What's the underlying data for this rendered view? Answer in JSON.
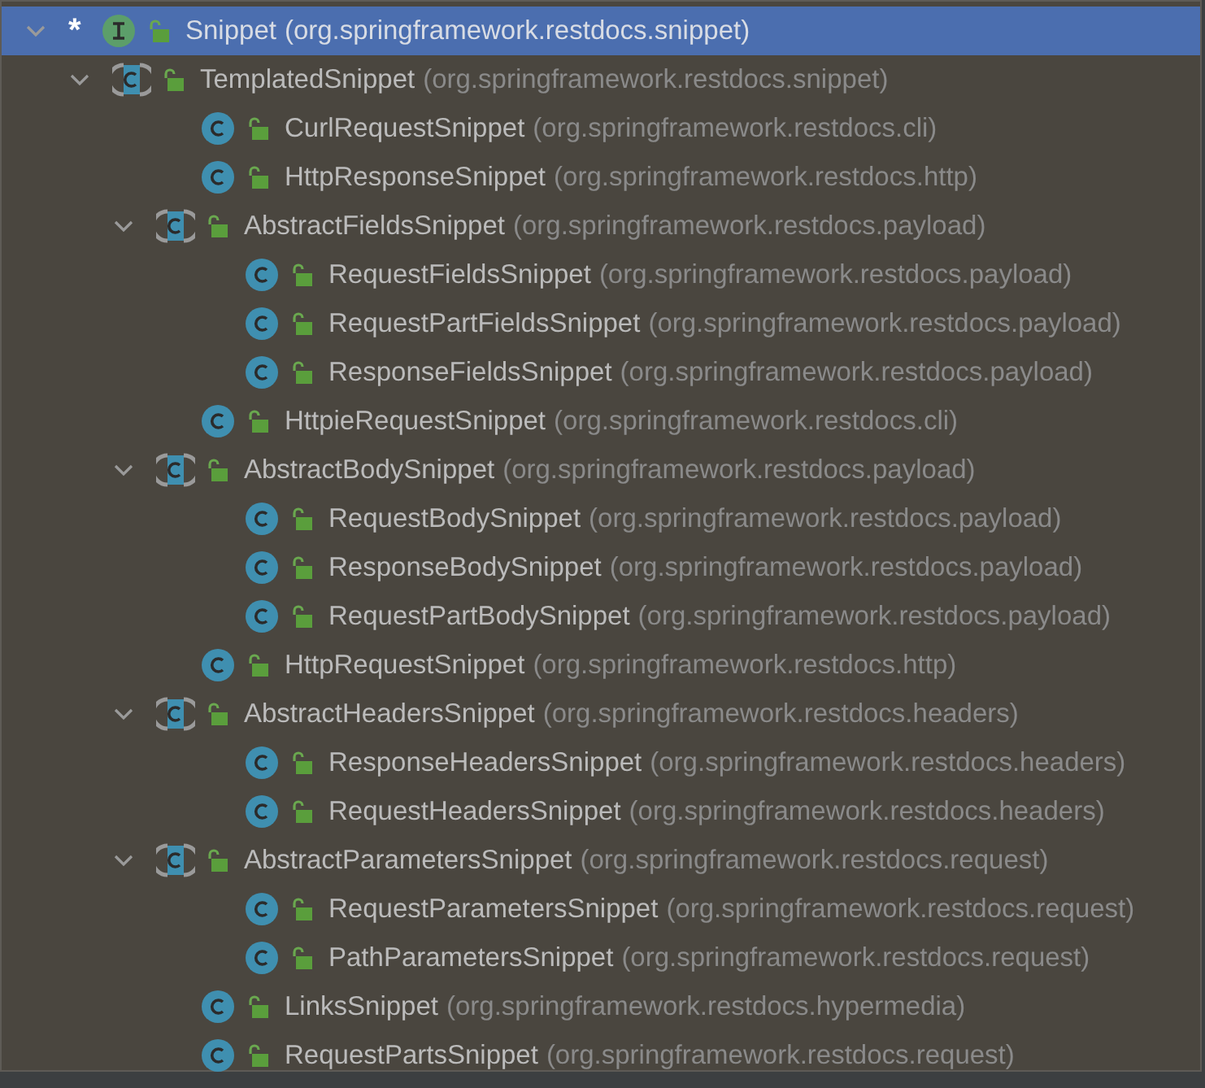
{
  "hierarchy": [
    {
      "name": "Snippet",
      "package": "(org.springframework.restdocs.snippet)",
      "kind": "interface",
      "marker": "*",
      "selected": true,
      "expanded": true,
      "children": [
        {
          "name": "TemplatedSnippet",
          "package": "(org.springframework.restdocs.snippet)",
          "kind": "abstract",
          "selected": false,
          "expanded": true,
          "children": [
            {
              "name": "CurlRequestSnippet",
              "package": "(org.springframework.restdocs.cli)",
              "kind": "class",
              "selected": false
            },
            {
              "name": "HttpResponseSnippet",
              "package": "(org.springframework.restdocs.http)",
              "kind": "class",
              "selected": false
            },
            {
              "name": "AbstractFieldsSnippet",
              "package": "(org.springframework.restdocs.payload)",
              "kind": "abstract",
              "selected": false,
              "expanded": true,
              "children": [
                {
                  "name": "RequestFieldsSnippet",
                  "package": "(org.springframework.restdocs.payload)",
                  "kind": "class",
                  "selected": false
                },
                {
                  "name": "RequestPartFieldsSnippet",
                  "package": "(org.springframework.restdocs.payload)",
                  "kind": "class",
                  "selected": false
                },
                {
                  "name": "ResponseFieldsSnippet",
                  "package": "(org.springframework.restdocs.payload)",
                  "kind": "class",
                  "selected": false
                }
              ]
            },
            {
              "name": "HttpieRequestSnippet",
              "package": "(org.springframework.restdocs.cli)",
              "kind": "class",
              "selected": false
            },
            {
              "name": "AbstractBodySnippet",
              "package": "(org.springframework.restdocs.payload)",
              "kind": "abstract",
              "selected": false,
              "expanded": true,
              "children": [
                {
                  "name": "RequestBodySnippet",
                  "package": "(org.springframework.restdocs.payload)",
                  "kind": "class",
                  "selected": false
                },
                {
                  "name": "ResponseBodySnippet",
                  "package": "(org.springframework.restdocs.payload)",
                  "kind": "class",
                  "selected": false
                },
                {
                  "name": "RequestPartBodySnippet",
                  "package": "(org.springframework.restdocs.payload)",
                  "kind": "class",
                  "selected": false
                }
              ]
            },
            {
              "name": "HttpRequestSnippet",
              "package": "(org.springframework.restdocs.http)",
              "kind": "class",
              "selected": false
            },
            {
              "name": "AbstractHeadersSnippet",
              "package": "(org.springframework.restdocs.headers)",
              "kind": "abstract",
              "selected": false,
              "expanded": true,
              "children": [
                {
                  "name": "ResponseHeadersSnippet",
                  "package": "(org.springframework.restdocs.headers)",
                  "kind": "class",
                  "selected": false
                },
                {
                  "name": "RequestHeadersSnippet",
                  "package": "(org.springframework.restdocs.headers)",
                  "kind": "class",
                  "selected": false
                }
              ]
            },
            {
              "name": "AbstractParametersSnippet",
              "package": "(org.springframework.restdocs.request)",
              "kind": "abstract",
              "selected": false,
              "expanded": true,
              "children": [
                {
                  "name": "RequestParametersSnippet",
                  "package": "(org.springframework.restdocs.request)",
                  "kind": "class",
                  "selected": false
                },
                {
                  "name": "PathParametersSnippet",
                  "package": "(org.springframework.restdocs.request)",
                  "kind": "class",
                  "selected": false
                }
              ]
            },
            {
              "name": "LinksSnippet",
              "package": "(org.springframework.restdocs.hypermedia)",
              "kind": "class",
              "selected": false
            },
            {
              "name": "RequestPartsSnippet",
              "package": "(org.springframework.restdocs.request)",
              "kind": "class",
              "selected": false
            }
          ]
        }
      ]
    }
  ]
}
